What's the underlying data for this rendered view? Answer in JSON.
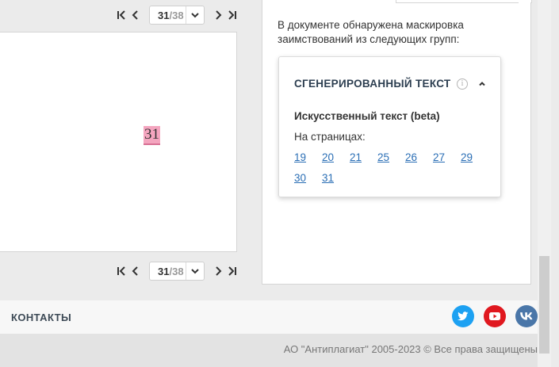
{
  "viewer": {
    "current_page": "31",
    "separator": "/",
    "total_pages": "38",
    "page_marker": "31"
  },
  "panel": {
    "intro": "В документе обнаружена маскировка заимствований из следующих групп:",
    "card": {
      "title": "СГЕНЕРИРОВАННЫЙ ТЕКСТ",
      "info_glyph": "i",
      "subtitle": "Искусственный текст (beta)",
      "pages_label": "На страницах:",
      "pages": [
        "19",
        "20",
        "21",
        "25",
        "26",
        "27",
        "29",
        "30",
        "31"
      ]
    }
  },
  "footer": {
    "contacts_label": "КОНТАКТЫ",
    "copyright": "АО \"Антиплагиат\" 2005-2023 © Все права защищены",
    "social": [
      {
        "name": "twitter-icon",
        "color": "#1da1f2"
      },
      {
        "name": "youtube-icon",
        "color": "#e0181f"
      },
      {
        "name": "vk-icon",
        "color": "#4a76a8"
      }
    ]
  },
  "colors": {
    "link": "#2a6eb5",
    "highlight": "#f4a5bf"
  }
}
